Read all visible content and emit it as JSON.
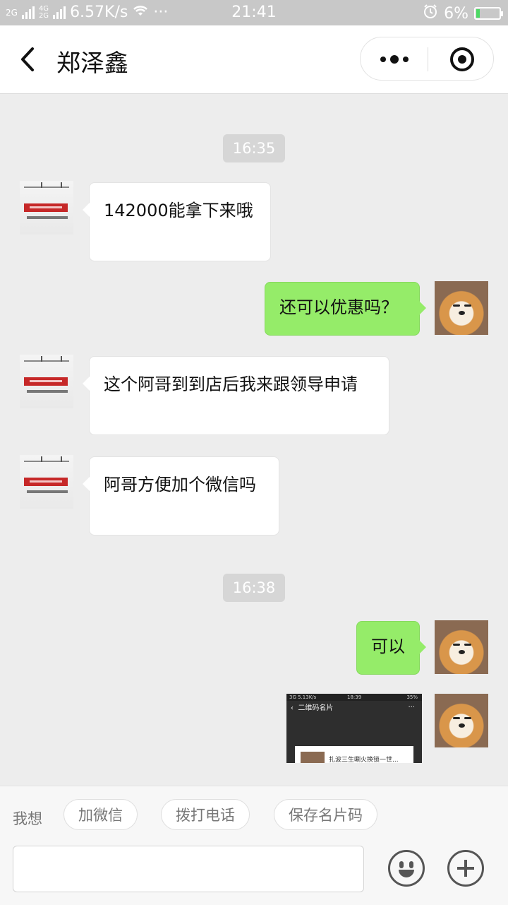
{
  "status_bar": {
    "network_left": "2G",
    "network_mid_top": "4G",
    "network_mid_bottom": "2G",
    "speed": "6.57K/s",
    "more": "···",
    "time": "21:41",
    "battery_percent": "6%"
  },
  "header": {
    "title": "郑泽鑫"
  },
  "chat": {
    "time_1": "16:35",
    "time_2": "16:38",
    "messages": [
      {
        "from": "dealer",
        "text": "142000能拿下来哦"
      },
      {
        "from": "me",
        "text": "还可以优惠吗？"
      },
      {
        "from": "dealer",
        "text": "这个阿哥到到店后我来跟领导申请"
      },
      {
        "from": "dealer",
        "text": "阿哥方便加个微信吗"
      },
      {
        "from": "me",
        "text": "可以"
      },
      {
        "from": "me",
        "type": "image"
      }
    ],
    "screenshot": {
      "status": "3G  5.13K/s",
      "time": "18:39",
      "battery": "35%",
      "title": "二维码名片",
      "card_text": "扎波三生唰火换锁一世...",
      "more": "···"
    }
  },
  "bottom": {
    "want_label": "我想",
    "chips": [
      "加微信",
      "拨打电话",
      "保存名片码"
    ],
    "input_value": ""
  }
}
